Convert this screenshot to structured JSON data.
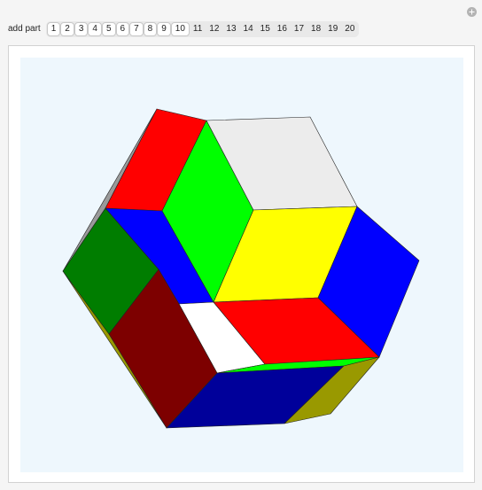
{
  "toolbar": {
    "label": "add part",
    "buttons": [
      {
        "label": "1",
        "active": true
      },
      {
        "label": "2",
        "active": true
      },
      {
        "label": "3",
        "active": true
      },
      {
        "label": "4",
        "active": true
      },
      {
        "label": "5",
        "active": true
      },
      {
        "label": "6",
        "active": true
      },
      {
        "label": "7",
        "active": true
      },
      {
        "label": "8",
        "active": true
      },
      {
        "label": "9",
        "active": true
      },
      {
        "label": "10",
        "active": true
      },
      {
        "label": "11",
        "active": false
      },
      {
        "label": "12",
        "active": false
      },
      {
        "label": "13",
        "active": false
      },
      {
        "label": "14",
        "active": false
      },
      {
        "label": "15",
        "active": false
      },
      {
        "label": "16",
        "active": false
      },
      {
        "label": "17",
        "active": false
      },
      {
        "label": "18",
        "active": false
      },
      {
        "label": "19",
        "active": false
      },
      {
        "label": "20",
        "active": false
      }
    ]
  },
  "controls": {
    "expand_icon": "plus-circle-icon"
  },
  "graphic": {
    "background": "#eef7fd",
    "face_colors": {
      "red": "#ff0000",
      "green": "#00ff00",
      "light-gray": "#ececec",
      "yellow": "#ffff00",
      "blue": "#0000ff",
      "dark-green": "#007d00",
      "dark-red": "#7d0000",
      "white": "#ffffff",
      "navy": "#00009a",
      "olive": "#999900",
      "gray": "#9a9a9a"
    }
  }
}
